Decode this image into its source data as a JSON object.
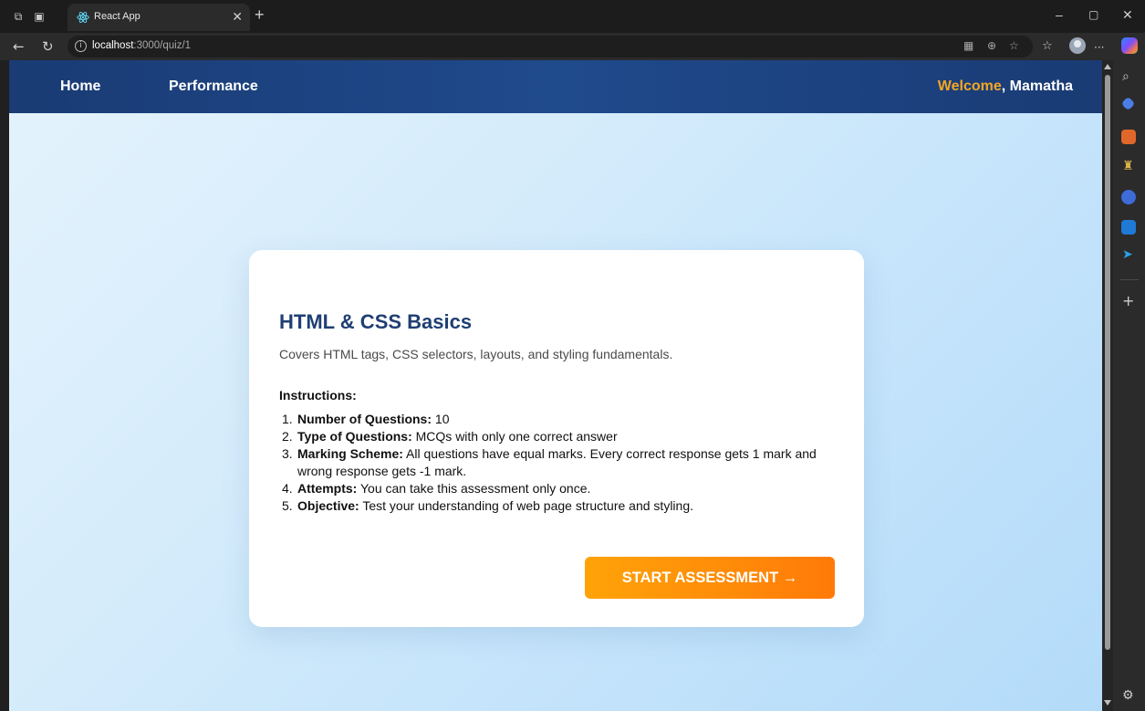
{
  "browser": {
    "tab": {
      "title": "React App"
    },
    "address": {
      "host": "localhost",
      "rest": ":3000/quiz/1"
    },
    "controls": {
      "minimize": "–",
      "restore": "▢",
      "close": "✕",
      "new_tab": "+",
      "tab_close": "✕"
    },
    "toolbar": {
      "back": "←",
      "refresh": "↻",
      "menu": "···"
    }
  },
  "nav": {
    "links": [
      "Home",
      "Performance"
    ],
    "welcome_word": "Welcome",
    "welcome_rest": ", Mamatha"
  },
  "quiz": {
    "title": "HTML & CSS Basics",
    "description": "Covers HTML tags, CSS selectors, layouts, and styling fundamentals.",
    "instructions_heading": "Instructions:",
    "instructions": [
      {
        "num": "1.",
        "label": "Number of Questions:",
        "text": " 10"
      },
      {
        "num": "2.",
        "label": "Type of Questions:",
        "text": " MCQs with only one correct answer"
      },
      {
        "num": "3.",
        "label": "Marking Scheme:",
        "text": " All questions have equal marks. Every correct response gets 1 mark and wrong response gets -1 mark."
      },
      {
        "num": "4.",
        "label": "Attempts:",
        "text": " You can take this assessment only once."
      },
      {
        "num": "5.",
        "label": "Objective:",
        "text": " Test your understanding of web page structure and styling."
      }
    ],
    "start_button": "START ASSESSMENT →"
  },
  "colors": {
    "navbar": "#1f4a8c",
    "accent": "#f5a623",
    "title": "#1f3f73",
    "button_start": "#ffa308",
    "button_end": "#ff7a08"
  }
}
